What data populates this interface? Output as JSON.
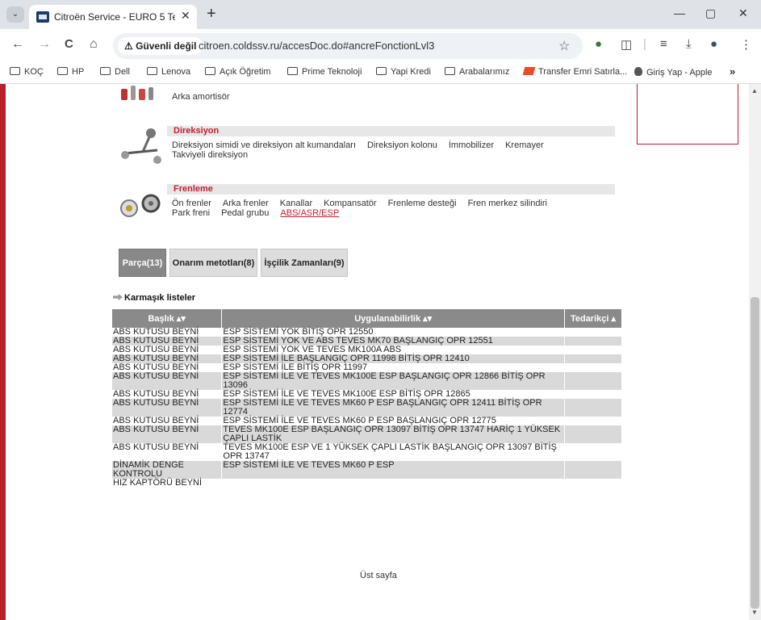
{
  "browser": {
    "tab_title": "Citroën Service - EURO 5 Teknik",
    "tab_close": "✕",
    "new_tab": "+",
    "win_min": "—",
    "win_max": "▢",
    "win_close": "✕",
    "back": "←",
    "forward": "→",
    "reload": "C",
    "home": "⌂",
    "security_label": "⚠ Güvenli değil",
    "url": "citroen.coldssv.ru/accesDoc.do#ancreFonctionLvl3",
    "star": "☆"
  },
  "bookmarks": [
    "KOÇ",
    "HP",
    "Dell",
    "Lenova",
    "Açık Öğretim",
    "Prime Teknoloji",
    "Yapi Kredi",
    "Arabalarımız",
    "Transfer Emri Satırla...",
    "Giriş Yap - Apple"
  ],
  "bookmarks_more": "»",
  "sections": {
    "suspension_line": "Arka amortisör",
    "direksiyon": {
      "title": "Direksiyon",
      "links": [
        "Direksiyon simidi ve direksiyon alt kumandaları",
        "Direksiyon kolonu",
        "İmmobilizer",
        "Kremayer",
        "Takviyeli direksiyon"
      ]
    },
    "frenleme": {
      "title": "Frenleme",
      "links": [
        "Ön frenler",
        "Arka frenler",
        "Kanallar",
        "Kompansatör",
        "Frenleme desteği",
        "Fren merkez silindiri",
        "Park freni",
        "Pedal grubu",
        "ABS/ASR/ESP"
      ]
    }
  },
  "tabs": [
    "Parça(13)",
    "Onarım metotları(8)",
    "İşçilik Zamanları(9)"
  ],
  "list_title": "Karmaşık listeler",
  "table": {
    "headers": [
      "Başlık ▴▾",
      "Uygulanabilirlik ▴▾",
      "Tedarikçi ▴"
    ],
    "rows": [
      [
        "ABS KUTUSU BEYNİ",
        "ESP SİSTEMİ YOK BİTİŞ OPR 12550"
      ],
      [
        "ABS KUTUSU BEYNİ",
        "ESP SİSTEMİ YOK VE ABS TEVES MK70 BAŞLANGIÇ OPR 12551"
      ],
      [
        "ABS KUTUSU BEYNİ",
        "ESP SİSTEMİ YOK VE TEVES MK100A ABS"
      ],
      [
        "ABS KUTUSU BEYNİ",
        "ESP SİSTEMİ İLE BAŞLANGIÇ OPR 11998 BİTİŞ OPR 12410"
      ],
      [
        "ABS KUTUSU BEYNİ",
        "ESP SİSTEMİ İLE BİTİŞ OPR 11997"
      ],
      [
        "ABS KUTUSU BEYNİ",
        "ESP SİSTEMİ İLE VE TEVES MK100E ESP BAŞLANGIÇ OPR 12866 BİTİŞ OPR 13096"
      ],
      [
        "ABS KUTUSU BEYNİ",
        "ESP SİSTEMİ İLE VE TEVES MK100E ESP BİTİŞ OPR 12865"
      ],
      [
        "ABS KUTUSU BEYNİ",
        "ESP SİSTEMİ İLE VE TEVES MK60 P ESP BAŞLANGIÇ OPR 12411 BİTİŞ OPR 12774"
      ],
      [
        "ABS KUTUSU BEYNİ",
        "ESP SİSTEMİ İLE VE TEVES MK60 P ESP BAŞLANGIÇ OPR 12775"
      ],
      [
        "ABS KUTUSU BEYNİ",
        "TEVES MK100E ESP BAŞLANGIÇ OPR 13097 BİTİŞ OPR 13747 HARİÇ 1 YÜKSEK ÇAPLI LASTİK"
      ],
      [
        "ABS KUTUSU BEYNİ",
        "TEVES MK100E ESP VE 1 YÜKSEK ÇAPLI LASTİK BAŞLANGIÇ OPR 13097 BİTİŞ OPR 13747"
      ],
      [
        "DİNAMİK DENGE KONTROLU",
        "ESP SİSTEMİ İLE VE TEVES MK60 P ESP"
      ],
      [
        "HIZ KAPTÖRÜ BEYNİ",
        ""
      ]
    ]
  },
  "top_link": "Üst sayfa"
}
